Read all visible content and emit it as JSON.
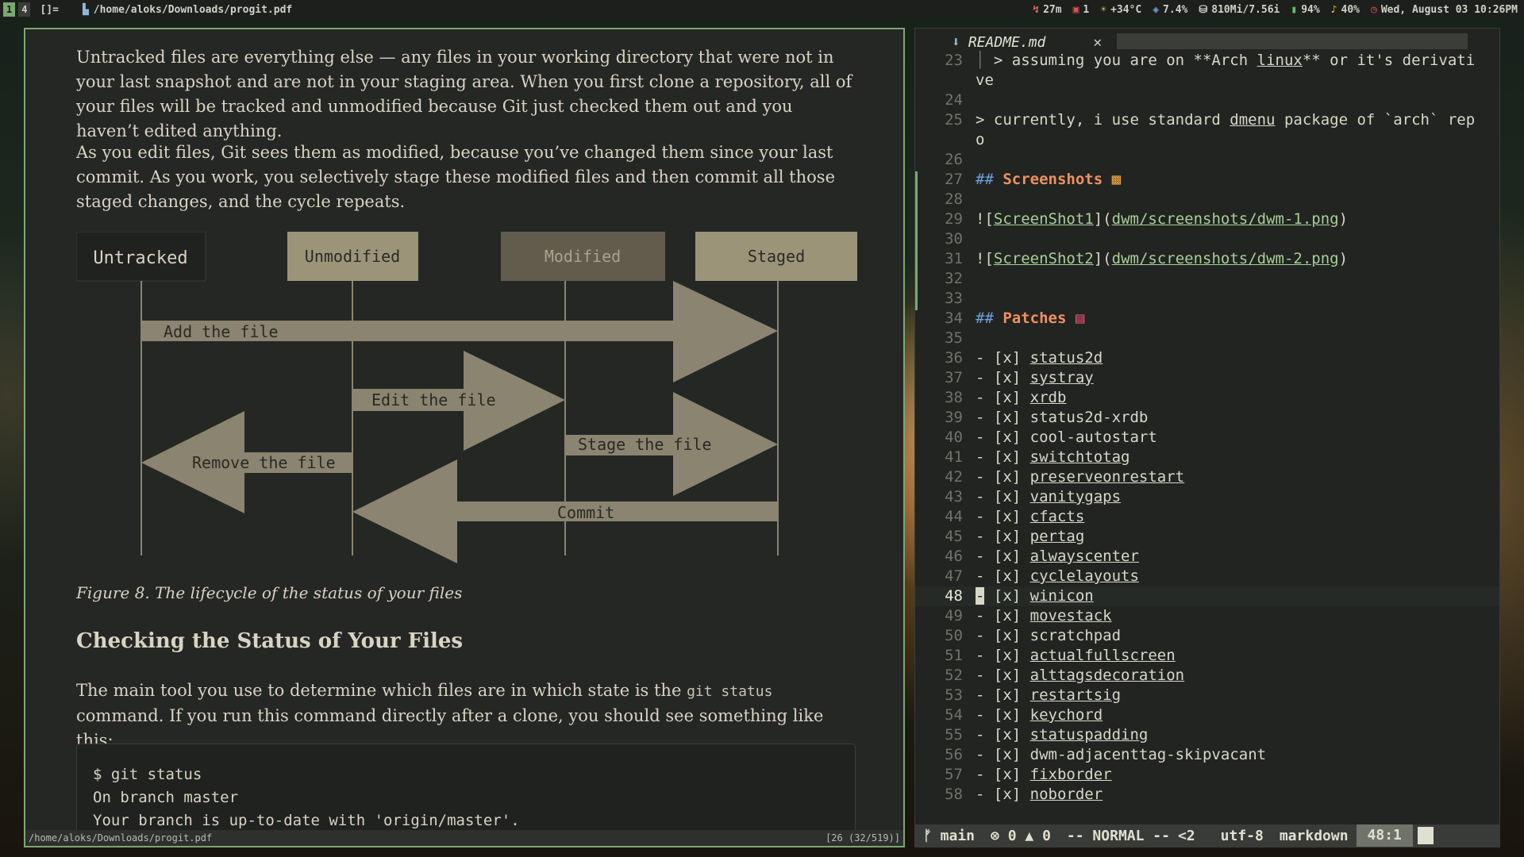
{
  "topbar": {
    "tags": [
      "1",
      "4"
    ],
    "layout": "[]=",
    "window_title": "/home/aloks/Downloads/progit.pdf",
    "status": {
      "uptime": "27m",
      "updates": "1",
      "temperature": "+34°C",
      "cpu": "7.4%",
      "memory": "810Mi/7.56i",
      "battery": "94%",
      "volume": "40%",
      "datetime": "Wed, August 03 10:26PM"
    }
  },
  "pdf": {
    "paragraph1": "Untracked files are everything else — any files in your working directory that were not in your last snapshot and are not in your staging area. When you first clone a repository, all of your files will be tracked and unmodified because Git just checked them out and you haven’t edited anything.",
    "paragraph2": "As you edit files, Git sees them as modified, because you’ve changed them since your last commit. As you work, you selectively stage these modified files and then commit all those staged changes, and the cycle repeats.",
    "figure": {
      "states": [
        "Untracked",
        "Unmodified",
        "Modified",
        "Staged"
      ],
      "arrows": [
        "Add the file",
        "Edit the file",
        "Stage the file",
        "Remove the file",
        "Commit"
      ]
    },
    "figure_caption": "Figure 8. The lifecycle of the status of your files",
    "section_heading": "Checking the Status of Your Files",
    "paragraph3_before": "The main tool you use to determine which files are in which state is the ",
    "paragraph3_code": "git status",
    "paragraph3_after": " command. If you run this command directly after a clone, you should see something like this:",
    "code_lines": [
      "$ git status",
      "On branch master",
      "Your branch is up-to-date with 'origin/master'."
    ],
    "status_path": "/home/aloks/Downloads/progit.pdf",
    "status_page": "[26 (32/519)]"
  },
  "editor": {
    "tab_name": "README.md",
    "mode": "-- NORMAL --",
    "branch": "main",
    "errors": "0",
    "warnings": "0",
    "indicator": "<2",
    "encoding": "utf-8",
    "filetype": "markdown",
    "position": "48:1",
    "patches": [
      "status2d",
      "systray",
      "xrdb",
      "status2d-xrdb",
      "cool-autostart",
      "switchtotag",
      "preserveonrestart",
      "vanitygaps",
      "cfacts",
      "pertag",
      "alwayscenter",
      "cyclelayouts",
      "winicon",
      "movestack",
      "scratchpad",
      "actualfullscreen",
      "alttagsdecoration",
      "restartsig",
      "keychord",
      "statuspadding",
      "dwm-adjacenttag-skipvacant",
      "fixborder",
      "noborder"
    ],
    "line23a": " > assuming you are on **Arch ",
    "line23b": "linux",
    "line23c": "** or it's derivati",
    "line23wrap": "ve",
    "line25a": "> currently, i use standard ",
    "line25b": "dmenu",
    "line25c": " package of `arch` rep",
    "line25wrap": "o",
    "screenshots_heading": "Screenshots",
    "ss1_label": "ScreenShot1",
    "ss1_url": "dwm/screenshots/dwm-1.png",
    "ss2_label": "ScreenShot2",
    "ss2_url": "dwm/screenshots/dwm-2.png",
    "patches_heading": "Patches"
  }
}
